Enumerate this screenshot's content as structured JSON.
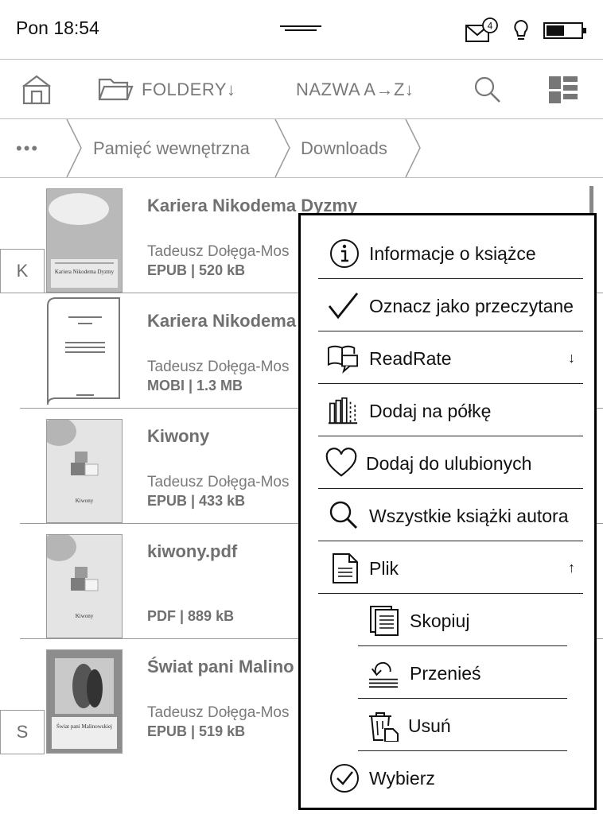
{
  "status": {
    "time": "Pon 18:54",
    "mail_count": "4"
  },
  "toolbar": {
    "folders_label": "FOLDERY↓",
    "sort_label": "NAZWA A→Z↓"
  },
  "breadcrumb": {
    "more": "•••",
    "items": [
      "Pamięć wewnętrzna",
      "Downloads"
    ]
  },
  "books": [
    {
      "title": "Kariera Nikodema Dyzmy",
      "author": "Tadeusz Dołęga-Mos",
      "meta": "EPUB | 520 kB",
      "cover_title": "Kariera Nikodema Dyzmy",
      "letter": "K"
    },
    {
      "title": "Kariera Nikodema",
      "author": "Tadeusz Dołęga-Mos",
      "meta": "MOBI | 1.3 MB"
    },
    {
      "title": "Kiwony",
      "author": "Tadeusz Dołęga-Mos",
      "meta": "EPUB | 433 kB",
      "cover_title": "Kiwony"
    },
    {
      "title": "kiwony.pdf",
      "author": "",
      "meta": "PDF | 889 kB",
      "cover_title": "Kiwony"
    },
    {
      "title": "Świat pani Malino",
      "author": "Tadeusz Dołęga-Mos",
      "meta": "EPUB | 519 kB",
      "cover_title": "Świat pani Malinowskiej",
      "letter": "S"
    }
  ],
  "menu": {
    "items": [
      {
        "label": "Informacje o książce",
        "icon": "info-icon"
      },
      {
        "label": "Oznacz jako przeczytane",
        "icon": "checkmark-icon"
      },
      {
        "label": "ReadRate",
        "icon": "book-comment-icon",
        "arrow": "↓"
      },
      {
        "label": "Dodaj na półkę",
        "icon": "bookshelf-icon"
      },
      {
        "label": "Dodaj do ulubionych",
        "icon": "heart-icon"
      },
      {
        "label": "Wszystkie książki autora",
        "icon": "search-icon"
      },
      {
        "label": "Plik",
        "icon": "file-icon",
        "arrow": "↑"
      },
      {
        "label": "Skopiuj",
        "icon": "copy-icon"
      },
      {
        "label": "Przenieś",
        "icon": "move-icon"
      },
      {
        "label": "Usuń",
        "icon": "trash-icon"
      },
      {
        "label": "Wybierz",
        "icon": "check-circle-icon"
      }
    ]
  }
}
